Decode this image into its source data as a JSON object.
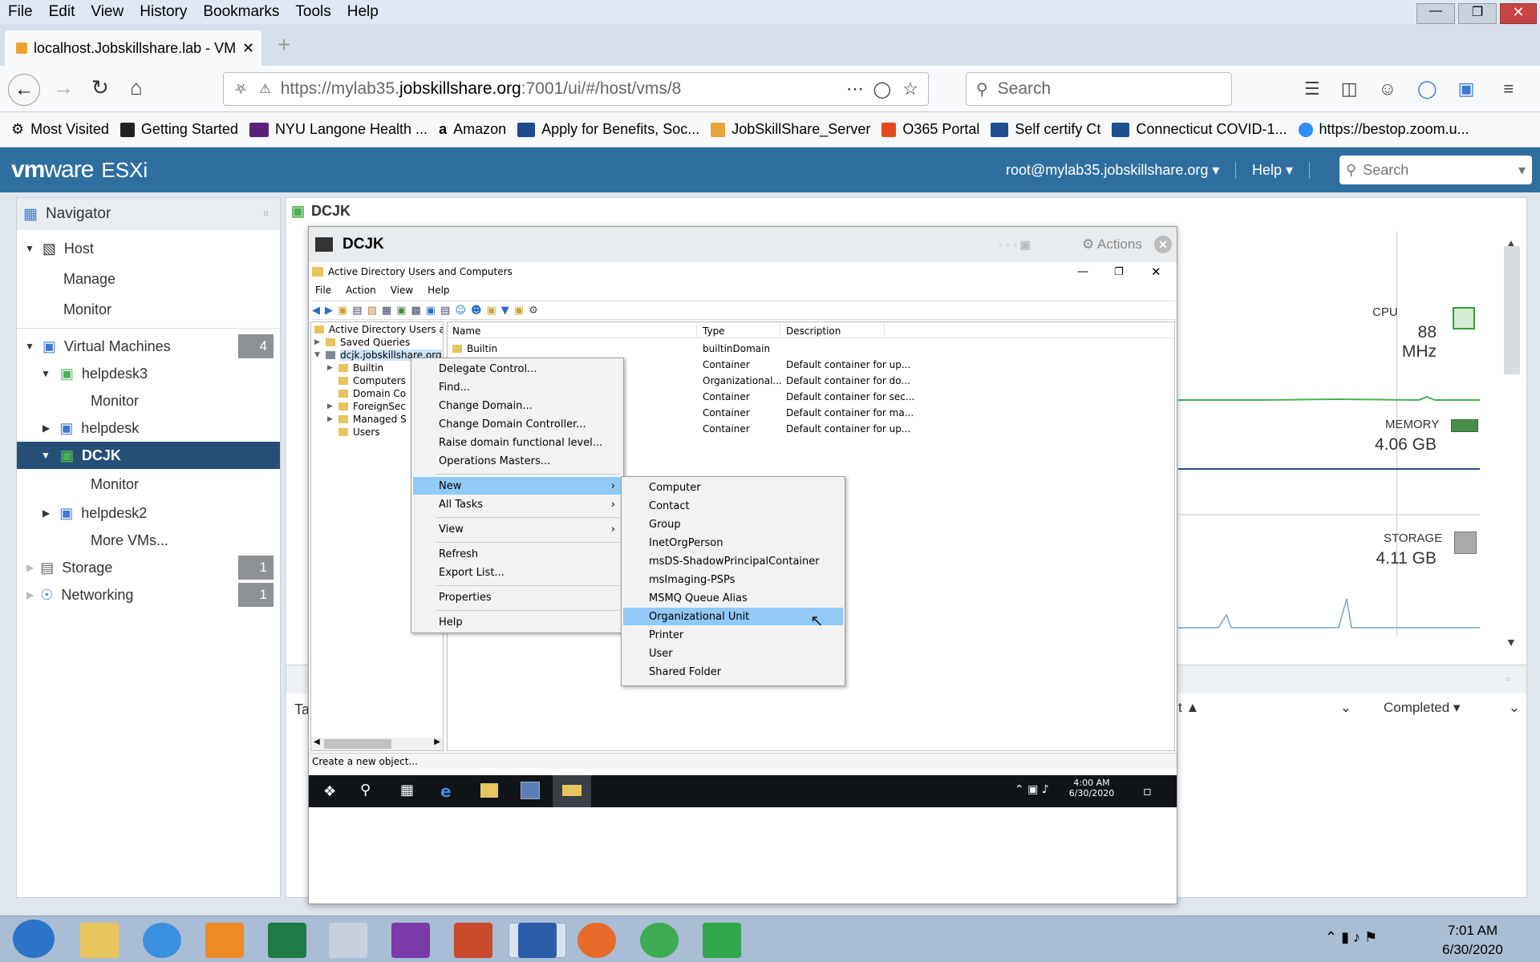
{
  "browser": {
    "menu": [
      "File",
      "Edit",
      "View",
      "History",
      "Bookmarks",
      "Tools",
      "Help"
    ],
    "tab_title": "localhost.Jobskillshare.lab - VM",
    "url_prefix": "https://mylab35.",
    "url_domain": "jobskillshare.org",
    "url_suffix": ":7001/ui/#/host/vms/8",
    "search_placeholder": "Search",
    "bookmarks": [
      "Most Visited",
      "Getting Started",
      "NYU Langone Health ...",
      "Amazon",
      "Apply for Benefits, Soc...",
      "JobSkillShare_Server",
      "O365 Portal",
      "Self certify Ct",
      "Connecticut COVID-1...",
      "https://bestop.zoom.u..."
    ]
  },
  "esxi": {
    "logo_vm": "vm",
    "logo_ware": "ware",
    "logo_product": "ESXi",
    "user": "root@mylab35.jobskillshare.org",
    "help": "Help",
    "search_placeholder": "Search"
  },
  "navigator": {
    "title": "Navigator",
    "host": "Host",
    "manage": "Manage",
    "monitor": "Monitor",
    "vms": "Virtual Machines",
    "vms_count": "4",
    "vm1": "helpdesk3",
    "vm1_monitor": "Monitor",
    "vm2": "helpdesk",
    "vm3": "DCJK",
    "vm3_monitor": "Monitor",
    "vm4": "helpdesk2",
    "more": "More VMs...",
    "storage": "Storage",
    "storage_count": "1",
    "networking": "Networking",
    "networking_count": "1"
  },
  "main": {
    "title": "DCJK",
    "cpu_label": "CPU",
    "cpu_value": "88 MHz",
    "mem_label": "MEMORY",
    "mem_value": "4.06 GB",
    "storage_label": "STORAGE",
    "storage_value": "4.11 GB",
    "tasks_ta": "Ta",
    "tasks_col": "t ▲",
    "completed": "Completed ▾"
  },
  "console": {
    "title": "DCJK",
    "actions": "Actions",
    "aduc_title": "Active Directory Users and Computers",
    "aduc_menu": [
      "File",
      "Action",
      "View",
      "Help"
    ],
    "tree_root": "Active Directory Users and Com",
    "tree": [
      "Saved Queries",
      "dcjk.jobskillshare.org",
      "Builtin",
      "Computers",
      "Domain Co",
      "ForeignSec",
      "Managed S",
      "Users"
    ],
    "cols": [
      "Name",
      "Type",
      "Description"
    ],
    "rows": [
      {
        "name": "Builtin",
        "type": "builtinDomain",
        "desc": ""
      },
      {
        "name": "",
        "type": "Container",
        "desc": "Default container for up..."
      },
      {
        "name": "",
        "type": "Organizational...",
        "desc": "Default container for do..."
      },
      {
        "name": "",
        "type": "Container",
        "desc": "Default container for sec..."
      },
      {
        "name": "",
        "type": "Container",
        "desc": "Default container for ma..."
      },
      {
        "name": "",
        "type": "Container",
        "desc": "Default container for up..."
      }
    ],
    "status": "Create a new object...",
    "clock_time": "4:00 AM",
    "clock_date": "6/30/2020"
  },
  "context_menu": {
    "items": [
      "Delegate Control...",
      "Find...",
      "Change Domain...",
      "Change Domain Controller...",
      "Raise domain functional level...",
      "Operations Masters...",
      "New",
      "All Tasks",
      "View",
      "Refresh",
      "Export List...",
      "Properties",
      "Help"
    ]
  },
  "submenu": {
    "items": [
      "Computer",
      "Contact",
      "Group",
      "InetOrgPerson",
      "msDS-ShadowPrincipalContainer",
      "msImaging-PSPs",
      "MSMQ Queue Alias",
      "Organizational Unit",
      "Printer",
      "User",
      "Shared Folder"
    ]
  },
  "taskbar": {
    "time": "7:01 AM",
    "date": "6/30/2020"
  },
  "colors": {
    "esxi_header": "#2f6fa0",
    "selected": "#264f78",
    "menu_highlight": "#91c9f7"
  }
}
